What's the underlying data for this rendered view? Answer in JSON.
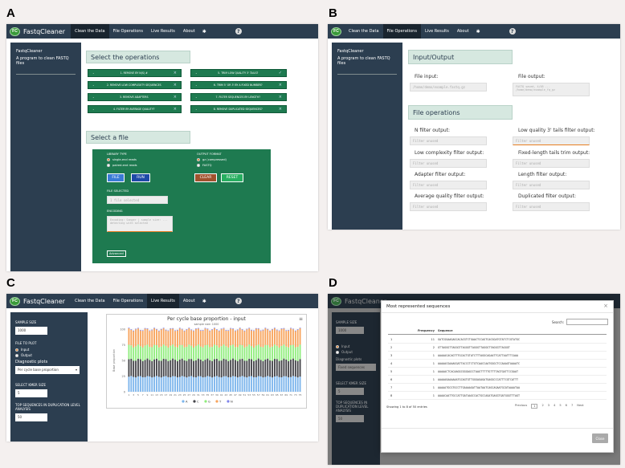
{
  "labels": {
    "a": "A",
    "b": "B",
    "c": "C",
    "d": "D"
  },
  "app": {
    "logo": "FC",
    "brand": "FastqCleaner",
    "nav": [
      "Clean the Data",
      "File Operations",
      "Live Results",
      "About"
    ],
    "help": "?",
    "gear": "✱"
  },
  "sidebar": {
    "title": "FastqCleaner",
    "subtitle": "A program to clean FASTQ files"
  },
  "panelA": {
    "ops_header": "Select the operations",
    "ops": [
      "1. REMOVE BY N(S) #",
      "2. REMOVE LOW COMPLEXITY SEQUENCES",
      "3. REMOVE ADAPTERS",
      "4. FILTER BY AVERAGE QUALITY?",
      "5. TRIM LOW QUALITY 3' TAILS?",
      "6. TRIM 5' OR 3' BY A FIXED NUMBER?",
      "7. FILTER SEQUENCES BY LENGTH?",
      "8. REMOVE DUPLICATED SEQUENCES?"
    ],
    "file_header": "Select a file",
    "library_type": "LIBRARY TYPE",
    "single": "single-end reads",
    "paired": "paired-end reads",
    "output_format": "OUTPUT FORMAT",
    "gz": "gz (compressed)",
    "fastq": "FASTQ",
    "file_btn": "FILE",
    "run_btn": "RUN",
    "clear_btn": "CLEAR",
    "reset_btn": "RESET",
    "file_selected": "FILE SELECTED",
    "file_value": "1 file selected",
    "encoding": "ENCODING",
    "encoding_value": "Encoding: Sanger | sample size: ... detecting with selected",
    "advanced": "Advanced"
  },
  "panelB": {
    "io_header": "Input/Output",
    "file_input": "File input:",
    "file_output": "File output:",
    "input_val": "/home/demo/example.fastq.gz",
    "output_val": "FASTQ saved, 4/05 ... /home/demo/example_fq_gz",
    "ops_header": "File operations",
    "left": [
      "N filter output:",
      "Low complexity filter output:",
      "Adapter filter output:",
      "Average quality filter output:"
    ],
    "right": [
      "Low quality 3' tails filter output:",
      "Fixed-length tails trim output:",
      "Length filter output:",
      "Duplicated filter output:"
    ],
    "placeholder": "Filter unused"
  },
  "panelC": {
    "sample_size_label": "SAMPLE SIZE",
    "sample_size": "1000",
    "files_to_plot": "FILE TO PLOT",
    "input": "Input",
    "output": "Output",
    "diag_label": "Diagnostic plots",
    "diag_value": "Per cycle base proportion",
    "kmer_label": "SELECT KMER SIZE",
    "kmer": "5",
    "top_label": "TOP SEQUENCES IN DUPLICATION LEVEL ANALYSIS",
    "top": "50",
    "chart_title": "Per cycle base proportion - input",
    "chart_sub": "sample size: 1000",
    "ylabel": "Base proportion",
    "menu": "≡"
  },
  "chart_data": {
    "type": "bar",
    "title": "Per cycle base proportion - input",
    "subtitle": "sample size: 1000",
    "ylabel": "Base proportion",
    "ylim": [
      0,
      100
    ],
    "categories": [
      "1",
      "2",
      "3",
      "4",
      "5",
      "6",
      "7",
      "8",
      "9",
      "10",
      "11",
      "12",
      "13",
      "14",
      "15",
      "16",
      "17",
      "18",
      "19",
      "20",
      "21",
      "22",
      "23",
      "24",
      "25",
      "26",
      "27",
      "28",
      "29",
      "30",
      "31",
      "32",
      "33",
      "34",
      "35",
      "36",
      "37",
      "38",
      "39",
      "40",
      "41",
      "42",
      "43",
      "44",
      "45",
      "46",
      "47",
      "48",
      "49",
      "50",
      "51",
      "52",
      "53",
      "54",
      "55",
      "56",
      "57",
      "58",
      "59",
      "60",
      "61",
      "62",
      "63",
      "64",
      "65",
      "66",
      "67",
      "68",
      "69",
      "70",
      "71",
      "72",
      "73",
      "74",
      "75"
    ],
    "ticks": [
      "1",
      "3",
      "5",
      "7",
      "9",
      "11",
      "13",
      "15",
      "17",
      "19",
      "21",
      "23",
      "25",
      "27",
      "29",
      "31",
      "33",
      "35",
      "37",
      "39",
      "41",
      "43",
      "45",
      "47",
      "49",
      "51",
      "53",
      "55",
      "57",
      "59",
      "61",
      "63",
      "65",
      "67",
      "69",
      "71",
      "73",
      "75"
    ],
    "yticks": [
      "0",
      "25",
      "50",
      "75",
      "100"
    ],
    "series": [
      {
        "name": "A",
        "color": "#7cb5ec",
        "value": 24
      },
      {
        "name": "C",
        "color": "#434348",
        "value": 27
      },
      {
        "name": "G",
        "color": "#90ed7d",
        "value": 22
      },
      {
        "name": "T",
        "color": "#f7a35c",
        "value": 26
      },
      {
        "name": "N",
        "color": "#8085e9",
        "value": 1
      }
    ]
  },
  "panelD": {
    "modal_title": "Most represented sequences",
    "close_x": "×",
    "search": "Search:",
    "col_i": "",
    "col_freq": "Frequency",
    "col_seq": "Sequence",
    "rows": [
      [
        "1",
        "11",
        "GATCGGAAGAGCACACGTCTGAACTCCAGTCACGGATGTATCTCGTATGC"
      ],
      [
        "2",
        "2",
        "GTTAGGGTTAGGGTTAGGGTTAGGGTTAGGGTTAGGGTTAGGGT"
      ],
      [
        "3",
        "1",
        "AAAAACACAGTTTGCACTGTATCTTTAGGCAGAATTCATTAATTTCAAA"
      ],
      [
        "4",
        "1",
        "AAAAACGAAAGGATTACCCTCTGTCAACCAATGGGCTCCAAAGTAAAATC"
      ],
      [
        "5",
        "1",
        "AAAAACTCACAAGGCGGGAGCCTAAGTTTTTGTTTTAGTGATTCCGAAT"
      ],
      [
        "6",
        "1",
        "AAAAAGAAAAAATGCAGTGTTGGGAGAGATGAGGCCCATTTCGTCATTT"
      ],
      [
        "7",
        "1",
        "AAAAATGCGTGCCTTGAAAAGATTAATAATCAGCAGAATGCATAAAATAA"
      ],
      [
        "8",
        "1",
        "AAAACAATTGCCATTGATAAGCCACTGCCAGATGAGGTGATGGGTTTAGT"
      ]
    ],
    "footer": "Showing 1 to 8 of 50 entries",
    "previous": "Previous",
    "pages": [
      "1",
      "2",
      "3",
      "4",
      "5",
      "6",
      "7"
    ],
    "next": "Next",
    "close": "Close",
    "bg_items": [
      "SAMPLE SIZE",
      "1000",
      "Input",
      "Output",
      "Diagnostic plots",
      "Fixed sequences",
      "SELECT KMER SIZE",
      "5",
      "TOP SEQUENCES IN DUPLICATION LEVEL ANALYSIS",
      "50"
    ]
  },
  "colors": {
    "nav": "#2c3e50",
    "green": "#1e7a50",
    "header": "#d6e8e0",
    "clear": "#a0522d",
    "blue": "#1f4aa8"
  }
}
